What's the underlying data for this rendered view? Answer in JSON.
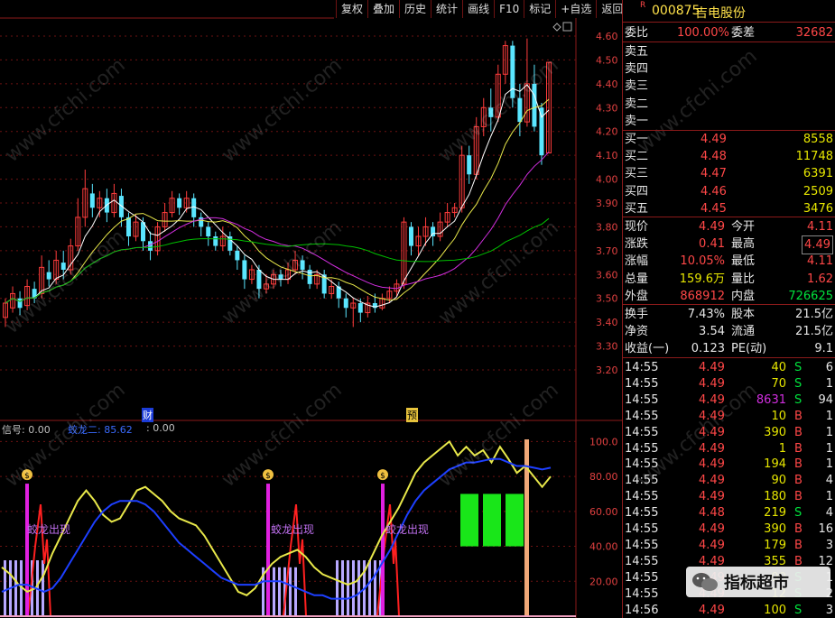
{
  "toolbar": {
    "buttons": [
      "复权",
      "叠加",
      "历史",
      "统计",
      "画线",
      "F10",
      "标记",
      "+自选",
      "返回"
    ]
  },
  "chart_header": {
    "signal_label": "信号: 0.00",
    "line2_label": "蛟龙二: 85.62",
    "line3_label": ": 0.00"
  },
  "price_axis": [
    "4.60",
    "4.50",
    "4.40",
    "4.30",
    "4.20",
    "4.10",
    "4.00",
    "3.90",
    "3.80",
    "3.70",
    "3.60",
    "3.50",
    "3.40",
    "3.30",
    "3.20"
  ],
  "indicator_axis": [
    "100.0",
    "80.00",
    "60.00",
    "40.00",
    "20.00"
  ],
  "markers": {
    "cai": "财",
    "yu": "预"
  },
  "signal_texts": [
    "蛟龙出现",
    "蛟龙出现",
    "蛟龙出现"
  ],
  "money_icon_text": "$",
  "watermark": "www.cfchi.com",
  "logo_text": "指标超市",
  "quote": {
    "r_badge": "R",
    "code": "000875",
    "name": "吉电股份",
    "weibi_label": "委比",
    "weibi_value": "100.00%",
    "weicha_label": "委差",
    "weicha_value": "32682",
    "asks": [
      {
        "label": "卖五",
        "price": "",
        "vol": ""
      },
      {
        "label": "卖四",
        "price": "",
        "vol": ""
      },
      {
        "label": "卖三",
        "price": "",
        "vol": ""
      },
      {
        "label": "卖二",
        "price": "",
        "vol": ""
      },
      {
        "label": "卖一",
        "price": "",
        "vol": ""
      }
    ],
    "bids": [
      {
        "label": "买一",
        "price": "4.49",
        "vol": "8558"
      },
      {
        "label": "买二",
        "price": "4.48",
        "vol": "11748"
      },
      {
        "label": "买三",
        "price": "4.47",
        "vol": "6391"
      },
      {
        "label": "买四",
        "price": "4.46",
        "vol": "2509"
      },
      {
        "label": "买五",
        "price": "4.45",
        "vol": "3476"
      }
    ],
    "stats": [
      {
        "l1": "现价",
        "v1": "4.49",
        "l2": "今开",
        "v2": "4.11"
      },
      {
        "l1": "涨跌",
        "v1": "0.41",
        "l2": "最高",
        "v2": "4.49"
      },
      {
        "l1": "涨幅",
        "v1": "10.05%",
        "l2": "最低",
        "v2": "4.11"
      },
      {
        "l1": "总量",
        "v1": "159.6万",
        "l2": "量比",
        "v2": "1.62"
      },
      {
        "l1": "外盘",
        "v1": "868912",
        "l2": "内盘",
        "v2": "726625"
      }
    ],
    "fund": [
      {
        "l1": "换手",
        "v1": "7.43%",
        "l2": "股本",
        "v2": "21.5亿"
      },
      {
        "l1": "净资",
        "v1": "3.54",
        "l2": "流通",
        "v2": "21.5亿"
      },
      {
        "l1": "收益(一)",
        "v1": "0.123",
        "l2": "PE(动)",
        "v2": "9.1"
      }
    ],
    "ticks": [
      {
        "t": "14:55",
        "p": "4.49",
        "v": "40",
        "d": "S",
        "n": "6"
      },
      {
        "t": "14:55",
        "p": "4.49",
        "v": "70",
        "d": "S",
        "n": "1"
      },
      {
        "t": "14:55",
        "p": "4.49",
        "v": "8631",
        "d": "S",
        "n": "94"
      },
      {
        "t": "14:55",
        "p": "4.49",
        "v": "10",
        "d": "B",
        "n": "1"
      },
      {
        "t": "14:55",
        "p": "4.49",
        "v": "390",
        "d": "B",
        "n": "1"
      },
      {
        "t": "14:55",
        "p": "4.49",
        "v": "1",
        "d": "B",
        "n": "1"
      },
      {
        "t": "14:55",
        "p": "4.49",
        "v": "194",
        "d": "B",
        "n": "1"
      },
      {
        "t": "14:55",
        "p": "4.49",
        "v": "90",
        "d": "B",
        "n": "4"
      },
      {
        "t": "14:55",
        "p": "4.49",
        "v": "180",
        "d": "B",
        "n": "1"
      },
      {
        "t": "14:55",
        "p": "4.48",
        "v": "219",
        "d": "S",
        "n": "4"
      },
      {
        "t": "14:55",
        "p": "4.49",
        "v": "390",
        "d": "B",
        "n": "16"
      },
      {
        "t": "14:55",
        "p": "4.49",
        "v": "179",
        "d": "B",
        "n": "3"
      },
      {
        "t": "14:55",
        "p": "4.49",
        "v": "355",
        "d": "B",
        "n": "12"
      },
      {
        "t": "14:55",
        "p": "4.49",
        "v": "90",
        "d": "S",
        "n": "1"
      },
      {
        "t": "14:55",
        "p": "4.49",
        "v": "12",
        "d": "S",
        "n": "2"
      },
      {
        "t": "14:56",
        "p": "4.49",
        "v": "100",
        "d": "S",
        "n": "3"
      }
    ]
  },
  "chart_data": [
    {
      "type": "candlestick",
      "title": "",
      "ylim": [
        3.2,
        4.6
      ],
      "y_ticks": [
        4.6,
        4.5,
        4.4,
        4.3,
        4.2,
        4.1,
        4.0,
        3.9,
        3.8,
        3.7,
        3.6,
        3.5,
        3.4,
        3.3,
        3.2
      ],
      "candles": [
        [
          3.42,
          3.48,
          3.38,
          3.5
        ],
        [
          3.46,
          3.52,
          3.44,
          3.55
        ],
        [
          3.5,
          3.46,
          3.43,
          3.53
        ],
        [
          3.47,
          3.55,
          3.45,
          3.58
        ],
        [
          3.54,
          3.5,
          3.48,
          3.57
        ],
        [
          3.52,
          3.63,
          3.5,
          3.68
        ],
        [
          3.61,
          3.58,
          3.55,
          3.66
        ],
        [
          3.58,
          3.66,
          3.56,
          3.7
        ],
        [
          3.65,
          3.62,
          3.58,
          3.7
        ],
        [
          3.62,
          3.72,
          3.6,
          3.75
        ],
        [
          3.72,
          3.84,
          3.7,
          3.92
        ],
        [
          3.84,
          3.96,
          3.8,
          4.04
        ],
        [
          3.94,
          3.88,
          3.84,
          3.98
        ],
        [
          3.88,
          3.92,
          3.84,
          3.95
        ],
        [
          3.92,
          3.86,
          3.82,
          3.96
        ],
        [
          3.86,
          3.94,
          3.84,
          3.98
        ],
        [
          3.93,
          3.84,
          3.8,
          3.96
        ],
        [
          3.84,
          3.76,
          3.72,
          3.86
        ],
        [
          3.76,
          3.82,
          3.74,
          3.85
        ],
        [
          3.82,
          3.74,
          3.7,
          3.84
        ],
        [
          3.74,
          3.7,
          3.66,
          3.78
        ],
        [
          3.7,
          3.8,
          3.68,
          3.82
        ],
        [
          3.8,
          3.86,
          3.78,
          3.9
        ],
        [
          3.86,
          3.92,
          3.84,
          3.95
        ],
        [
          3.92,
          3.88,
          3.85,
          3.94
        ],
        [
          3.88,
          3.92,
          3.86,
          3.95
        ],
        [
          3.92,
          3.84,
          3.8,
          3.94
        ],
        [
          3.84,
          3.8,
          3.76,
          3.86
        ],
        [
          3.8,
          3.76,
          3.72,
          3.82
        ],
        [
          3.76,
          3.72,
          3.7,
          3.78
        ],
        [
          3.72,
          3.76,
          3.7,
          3.8
        ],
        [
          3.76,
          3.7,
          3.68,
          3.78
        ],
        [
          3.7,
          3.66,
          3.62,
          3.72
        ],
        [
          3.66,
          3.58,
          3.54,
          3.68
        ],
        [
          3.58,
          3.62,
          3.56,
          3.64
        ],
        [
          3.62,
          3.54,
          3.5,
          3.64
        ],
        [
          3.54,
          3.56,
          3.52,
          3.6
        ],
        [
          3.56,
          3.6,
          3.54,
          3.62
        ],
        [
          3.6,
          3.58,
          3.55,
          3.62
        ],
        [
          3.58,
          3.62,
          3.56,
          3.65
        ],
        [
          3.62,
          3.66,
          3.6,
          3.7
        ],
        [
          3.66,
          3.62,
          3.58,
          3.68
        ],
        [
          3.62,
          3.56,
          3.54,
          3.64
        ],
        [
          3.56,
          3.6,
          3.54,
          3.62
        ],
        [
          3.6,
          3.52,
          3.5,
          3.62
        ],
        [
          3.52,
          3.55,
          3.5,
          3.58
        ],
        [
          3.55,
          3.5,
          3.46,
          3.57
        ],
        [
          3.5,
          3.46,
          3.42,
          3.52
        ],
        [
          3.46,
          3.48,
          3.38,
          3.5
        ],
        [
          3.48,
          3.44,
          3.4,
          3.5
        ],
        [
          3.44,
          3.48,
          3.42,
          3.51
        ],
        [
          3.48,
          3.46,
          3.44,
          3.52
        ],
        [
          3.46,
          3.5,
          3.45,
          3.52
        ],
        [
          3.5,
          3.53,
          3.48,
          3.55
        ],
        [
          3.53,
          3.56,
          3.51,
          3.58
        ],
        [
          3.56,
          3.82,
          3.54,
          3.84
        ],
        [
          3.8,
          3.72,
          3.68,
          3.82
        ],
        [
          3.72,
          3.76,
          3.68,
          3.8
        ],
        [
          3.76,
          3.8,
          3.72,
          3.84
        ],
        [
          3.8,
          3.76,
          3.72,
          3.82
        ],
        [
          3.76,
          3.82,
          3.74,
          3.86
        ],
        [
          3.82,
          3.86,
          3.8,
          3.9
        ],
        [
          3.86,
          3.88,
          3.84,
          3.9
        ],
        [
          3.88,
          4.1,
          3.86,
          4.14
        ],
        [
          4.1,
          4.02,
          3.98,
          4.14
        ],
        [
          4.02,
          4.22,
          4.0,
          4.26
        ],
        [
          4.22,
          4.3,
          4.18,
          4.34
        ],
        [
          4.3,
          4.26,
          4.2,
          4.38
        ],
        [
          4.26,
          4.44,
          4.24,
          4.48
        ],
        [
          4.44,
          4.56,
          4.4,
          4.58
        ],
        [
          4.56,
          4.34,
          4.3,
          4.58
        ],
        [
          4.34,
          4.24,
          4.18,
          4.4
        ],
        [
          4.24,
          4.4,
          4.22,
          4.59
        ],
        [
          4.4,
          4.22,
          4.2,
          4.48
        ],
        [
          4.3,
          4.1,
          4.06,
          4.32
        ],
        [
          4.11,
          4.49,
          4.11,
          4.49
        ]
      ],
      "series": [
        {
          "color": "#ffffff",
          "ma": 5
        },
        {
          "color": "#e8e84a",
          "ma": 10
        },
        {
          "color": "#d22ee0",
          "ma": 20
        },
        {
          "color": "#00c000",
          "ma": 40
        }
      ]
    },
    {
      "type": "line",
      "title": "",
      "ylim": [
        0,
        110
      ],
      "series": [
        {
          "color": "#e8e84a",
          "values": [
            28,
            24,
            18,
            14,
            16,
            24,
            36,
            46,
            56,
            66,
            72,
            66,
            58,
            54,
            56,
            64,
            72,
            74,
            70,
            66,
            60,
            56,
            54,
            52,
            46,
            38,
            30,
            22,
            14,
            12,
            16,
            24,
            30,
            34,
            36,
            38,
            34,
            28,
            24,
            22,
            20,
            18,
            20,
            26,
            36,
            46,
            54,
            62,
            72,
            82,
            88,
            92,
            96,
            100,
            92,
            97,
            92,
            95,
            88,
            97,
            90,
            82,
            86,
            80,
            74,
            80
          ]
        },
        {
          "color": "#1d3fff",
          "values": [
            14,
            16,
            18,
            18,
            16,
            14,
            16,
            22,
            30,
            38,
            46,
            54,
            60,
            64,
            66,
            66,
            66,
            64,
            60,
            54,
            48,
            42,
            38,
            34,
            30,
            26,
            22,
            20,
            18,
            18,
            18,
            20,
            20,
            20,
            18,
            16,
            14,
            12,
            12,
            10,
            10,
            10,
            12,
            16,
            22,
            30,
            38,
            48,
            58,
            66,
            72,
            76,
            80,
            84,
            86,
            88,
            88,
            89,
            90,
            90,
            88,
            86,
            86,
            85,
            84,
            85
          ]
        }
      ],
      "signal_positions": [
        2,
        20,
        40
      ],
      "signal_value": 80,
      "green_bars": [
        [
          510,
          530
        ],
        [
          535,
          555
        ],
        [
          560,
          580
        ]
      ],
      "green_range": [
        40,
        70
      ],
      "orange_bar_x": 583
    }
  ]
}
